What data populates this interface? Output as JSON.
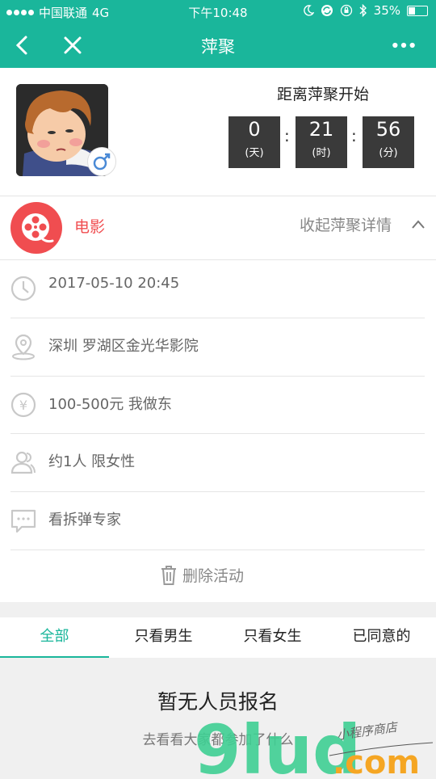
{
  "status_bar": {
    "carrier": "中国联通",
    "network": "4G",
    "time": "下午10:48",
    "battery": "35%",
    "battery_level": 0.35
  },
  "nav": {
    "title": "萍聚",
    "back_icon": "back-arrow-icon",
    "close_icon": "close-icon",
    "more_icon": "more-dots-icon"
  },
  "countdown": {
    "title": "距离萍聚开始",
    "days": "0",
    "days_unit": "(天)",
    "hours": "21",
    "hours_unit": "(时)",
    "minutes": "56",
    "minutes_unit": "(分)"
  },
  "category": {
    "label": "电影",
    "collapse_label": "收起萍聚详情"
  },
  "details": {
    "datetime": "2017-05-10 20:45",
    "location": "深圳 罗湖区金光华影院",
    "budget": "100-500元 我做东",
    "people": "约1人 限女性",
    "note": "看拆弹专家"
  },
  "actions": {
    "delete_label": "删除活动"
  },
  "tabs": [
    {
      "label": "全部",
      "active": true
    },
    {
      "label": "只看男生",
      "active": false
    },
    {
      "label": "只看女生",
      "active": false
    },
    {
      "label": "已同意的",
      "active": false
    }
  ],
  "empty_state": {
    "title": "暂无人员报名",
    "subtitle": "去看看大家都参加了什么"
  },
  "watermark": {
    "brand": "9lud.com",
    "tagline": "小程序商店"
  },
  "colors": {
    "accent": "#1ab69b",
    "movie_red": "#f04d50",
    "countdown_box": "#3a3a3a"
  }
}
